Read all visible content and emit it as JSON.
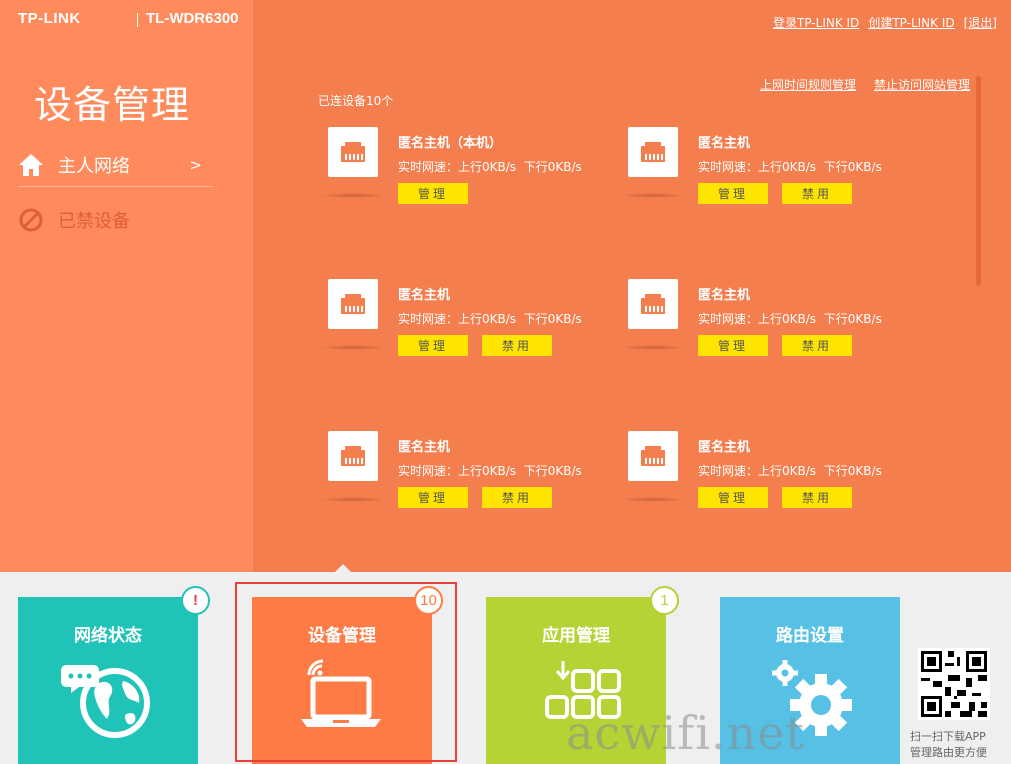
{
  "brand": {
    "logo": "TP-LINK",
    "model": "TL-WDR6300"
  },
  "header_links": [
    "登录TP-LINK ID",
    "创建TP-LINK ID",
    "[退出]"
  ],
  "sidebar": {
    "title": "设备管理",
    "items": [
      {
        "label": "主人网络",
        "arrow": ">",
        "icon": "home-icon"
      },
      {
        "label": "已禁设备",
        "icon": "ban-icon"
      }
    ]
  },
  "main": {
    "sub_links": [
      "上网时间规则管理",
      "禁止访问网站管理"
    ],
    "connected_count": "已连设备10个",
    "devices": [
      {
        "name": "匿名主机（本机）",
        "speed_label": "实时网速：",
        "up": "上行0KB/s",
        "down": "下行0KB/s",
        "manage": "管理",
        "block": ""
      },
      {
        "name": "匿名主机",
        "speed_label": "实时网速：",
        "up": "上行0KB/s",
        "down": "下行0KB/s",
        "manage": "管理",
        "block": "禁用"
      },
      {
        "name": "匿名主机",
        "speed_label": "实时网速：",
        "up": "上行0KB/s",
        "down": "下行0KB/s",
        "manage": "管理",
        "block": "禁用"
      },
      {
        "name": "匿名主机",
        "speed_label": "实时网速：",
        "up": "上行0KB/s",
        "down": "下行0KB/s",
        "manage": "管理",
        "block": "禁用"
      },
      {
        "name": "匿名主机",
        "speed_label": "实时网速：",
        "up": "上行0KB/s",
        "down": "下行0KB/s",
        "manage": "管理",
        "block": "禁用"
      },
      {
        "name": "匿名主机",
        "speed_label": "实时网速：",
        "up": "上行0KB/s",
        "down": "下行0KB/s",
        "manage": "管理",
        "block": "禁用"
      }
    ]
  },
  "tiles": [
    {
      "title": "网络状态",
      "badge": "!",
      "color": "#1fc3b7",
      "icon": "globe-chat-icon"
    },
    {
      "title": "设备管理",
      "badge": "10",
      "color": "#ff7b45",
      "icon": "laptop-wifi-icon",
      "selected": true
    },
    {
      "title": "应用管理",
      "badge": "1",
      "color": "#b6d335",
      "icon": "apps-grid-icon"
    },
    {
      "title": "路由设置",
      "badge": "",
      "color": "#56c1e5",
      "icon": "gears-icon"
    }
  ],
  "qr": {
    "line1": "扫一扫下载APP",
    "line2": "管理路由更方便"
  },
  "watermark": "acwifi.net"
}
